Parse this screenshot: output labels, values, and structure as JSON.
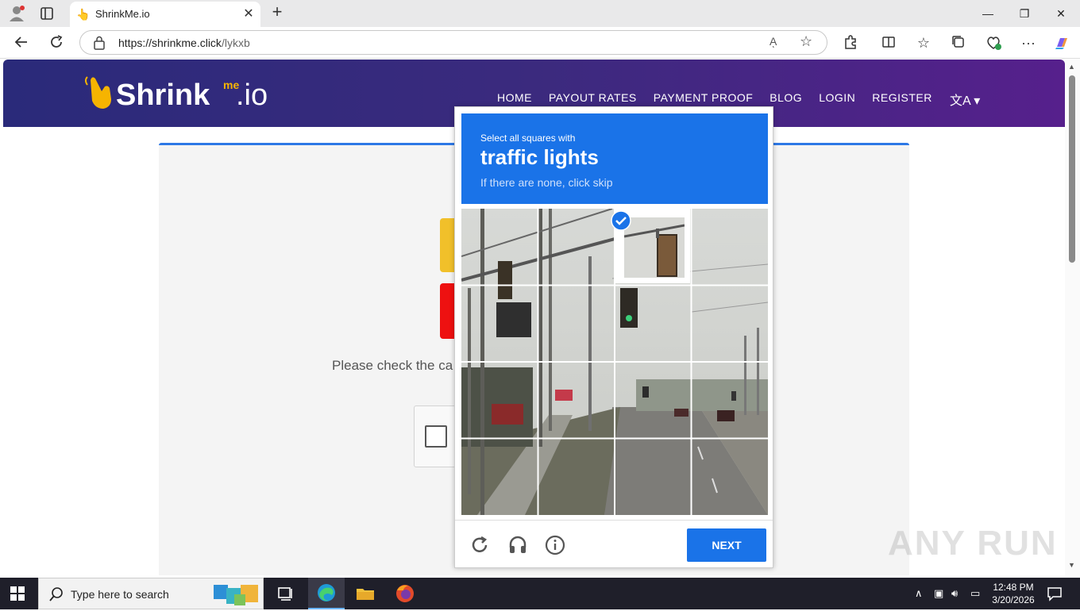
{
  "browser": {
    "tab_title": "ShrinkMe.io",
    "tab_favicon": "👆",
    "url_host": "https://shrinkme.click",
    "url_path": "/lykxb",
    "read_aloud": "Aͅ",
    "new_tab_symbol": "+",
    "window_controls": {
      "minimize": "—",
      "restore": "❐",
      "close": "✕"
    }
  },
  "site": {
    "logo_main": "Shrink",
    "logo_me": "me",
    "logo_suffix": ".io",
    "nav": [
      "HOME",
      "PAYOUT RATES",
      "PAYMENT PROOF",
      "BLOG",
      "LOGIN",
      "REGISTER"
    ],
    "lang_symbol": "文A ▾",
    "check_text": "Please check the ca"
  },
  "captcha": {
    "prompt": "Select all squares with",
    "object": "traffic lights",
    "hint": "If there are none, click skip",
    "next_label": "NEXT",
    "selected_tiles": [
      2
    ]
  },
  "watermark": "ANY RUN",
  "taskbar": {
    "search_placeholder": "Type here to search",
    "time": "12:48 PM",
    "date": "3/20/2026"
  },
  "colors": {
    "captcha_blue": "#1a73e8",
    "header_gradient_start": "#2a2a7a",
    "header_gradient_end": "#56208c",
    "accent_yellow": "#f1c02a",
    "accent_red": "#ee1111"
  }
}
